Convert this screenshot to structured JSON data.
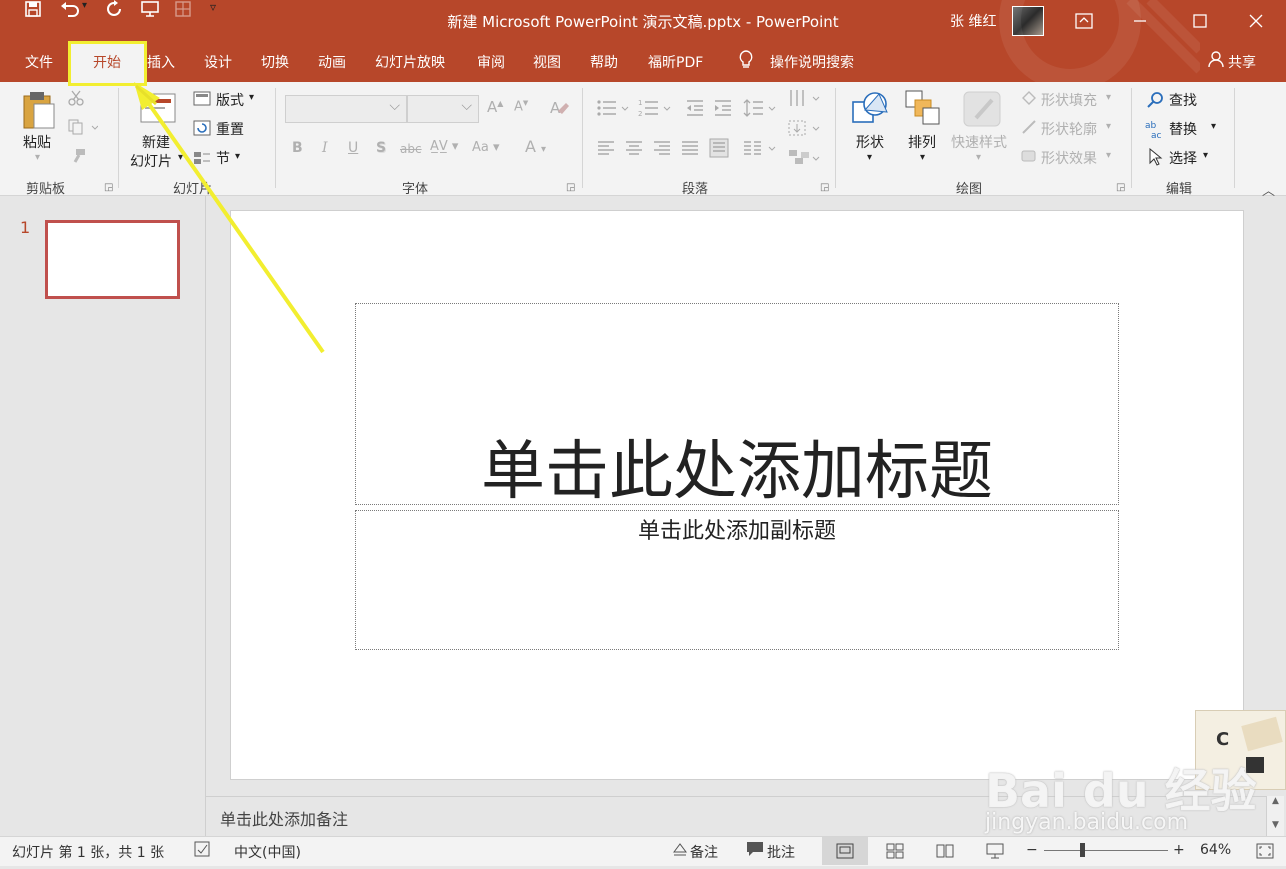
{
  "window": {
    "title": "新建 Microsoft PowerPoint 演示文稿.pptx  -  PowerPoint",
    "user": "张 维红",
    "controls": [
      "ribbon-display-icon",
      "minimize-icon",
      "maximize-icon",
      "close-icon"
    ]
  },
  "quick_access": [
    "save-icon",
    "undo-icon",
    "redo-icon",
    "present-icon",
    "touch-mode-icon",
    "customize-qat-icon"
  ],
  "tabs": {
    "file": "文件",
    "home": "开始",
    "insert": "插入",
    "design": "设计",
    "transitions": "切换",
    "animations": "动画",
    "slideshow": "幻灯片放映",
    "review": "审阅",
    "view": "视图",
    "help": "帮助",
    "foxit": "福昕PDF",
    "tellme": "操作说明搜索",
    "share": "共享"
  },
  "ribbon": {
    "clipboard": {
      "label": "剪贴板",
      "paste": "粘贴"
    },
    "slides": {
      "label": "幻灯片",
      "new_slide_1": "新建",
      "new_slide_2": "幻灯片",
      "layout": "版式",
      "reset": "重置",
      "section": "节"
    },
    "font": {
      "label": "字体"
    },
    "paragraph": {
      "label": "段落"
    },
    "drawing": {
      "label": "绘图",
      "shapes": "形状",
      "arrange": "排列",
      "quick_styles": "快速样式",
      "fill": "形状填充",
      "outline": "形状轮廓",
      "effects": "形状效果"
    },
    "editing": {
      "label": "编辑",
      "find": "查找",
      "replace": "替换",
      "select": "选择"
    }
  },
  "slide_pane": {
    "slide_number": "1"
  },
  "slide": {
    "title_placeholder": "单击此处添加标题",
    "subtitle_placeholder": "单击此处添加副标题"
  },
  "notes_placeholder": "单击此处添加备注",
  "status": {
    "slide_info": "幻灯片 第 1 张，共 1 张",
    "language": "中文(中国)",
    "notes": "备注",
    "comments": "批注",
    "zoom": "64%",
    "zoom_level": 0.64
  },
  "watermark": {
    "brand": "Bai du 经验",
    "url": "jingyan.baidu.com"
  },
  "colors": {
    "accent": "#b7472a",
    "highlight": "#f2ee30",
    "thumb_border": "#c0504d"
  }
}
